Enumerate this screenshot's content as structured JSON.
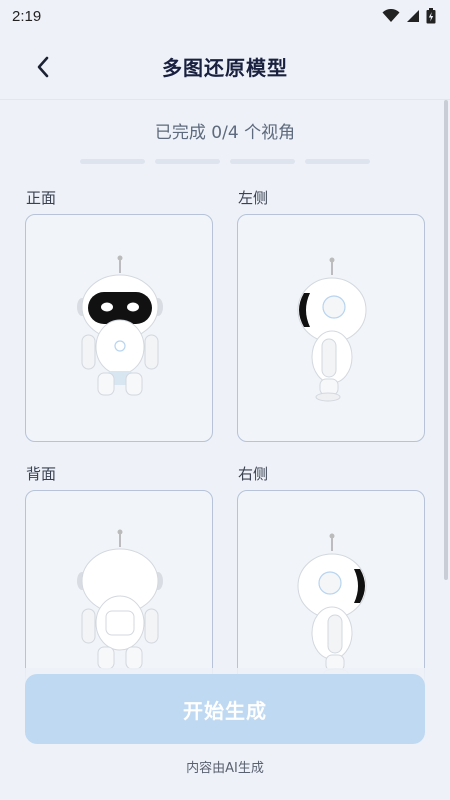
{
  "status_bar": {
    "time": "2:19",
    "icons": [
      "wifi-icon",
      "signal-icon",
      "battery-icon"
    ]
  },
  "header": {
    "back_icon": "chevron-left-icon",
    "title": "多图还原模型"
  },
  "progress": {
    "text": "已完成 0/4 个视角",
    "completed": 0,
    "total": 4
  },
  "views": [
    {
      "label": "正面",
      "image": "robot-front-view"
    },
    {
      "label": "左侧",
      "image": "robot-left-side-view"
    },
    {
      "label": "背面",
      "image": "robot-back-view"
    },
    {
      "label": "右侧",
      "image": "robot-right-side-view"
    }
  ],
  "actions": {
    "generate_label": "开始生成"
  },
  "footer": {
    "ai_note": "内容由AI生成"
  },
  "colors": {
    "background": "#eef2f8",
    "button_disabled": "#bfd9f2",
    "card_border": "#b6c3d8",
    "progress_empty": "#dde4ee"
  }
}
